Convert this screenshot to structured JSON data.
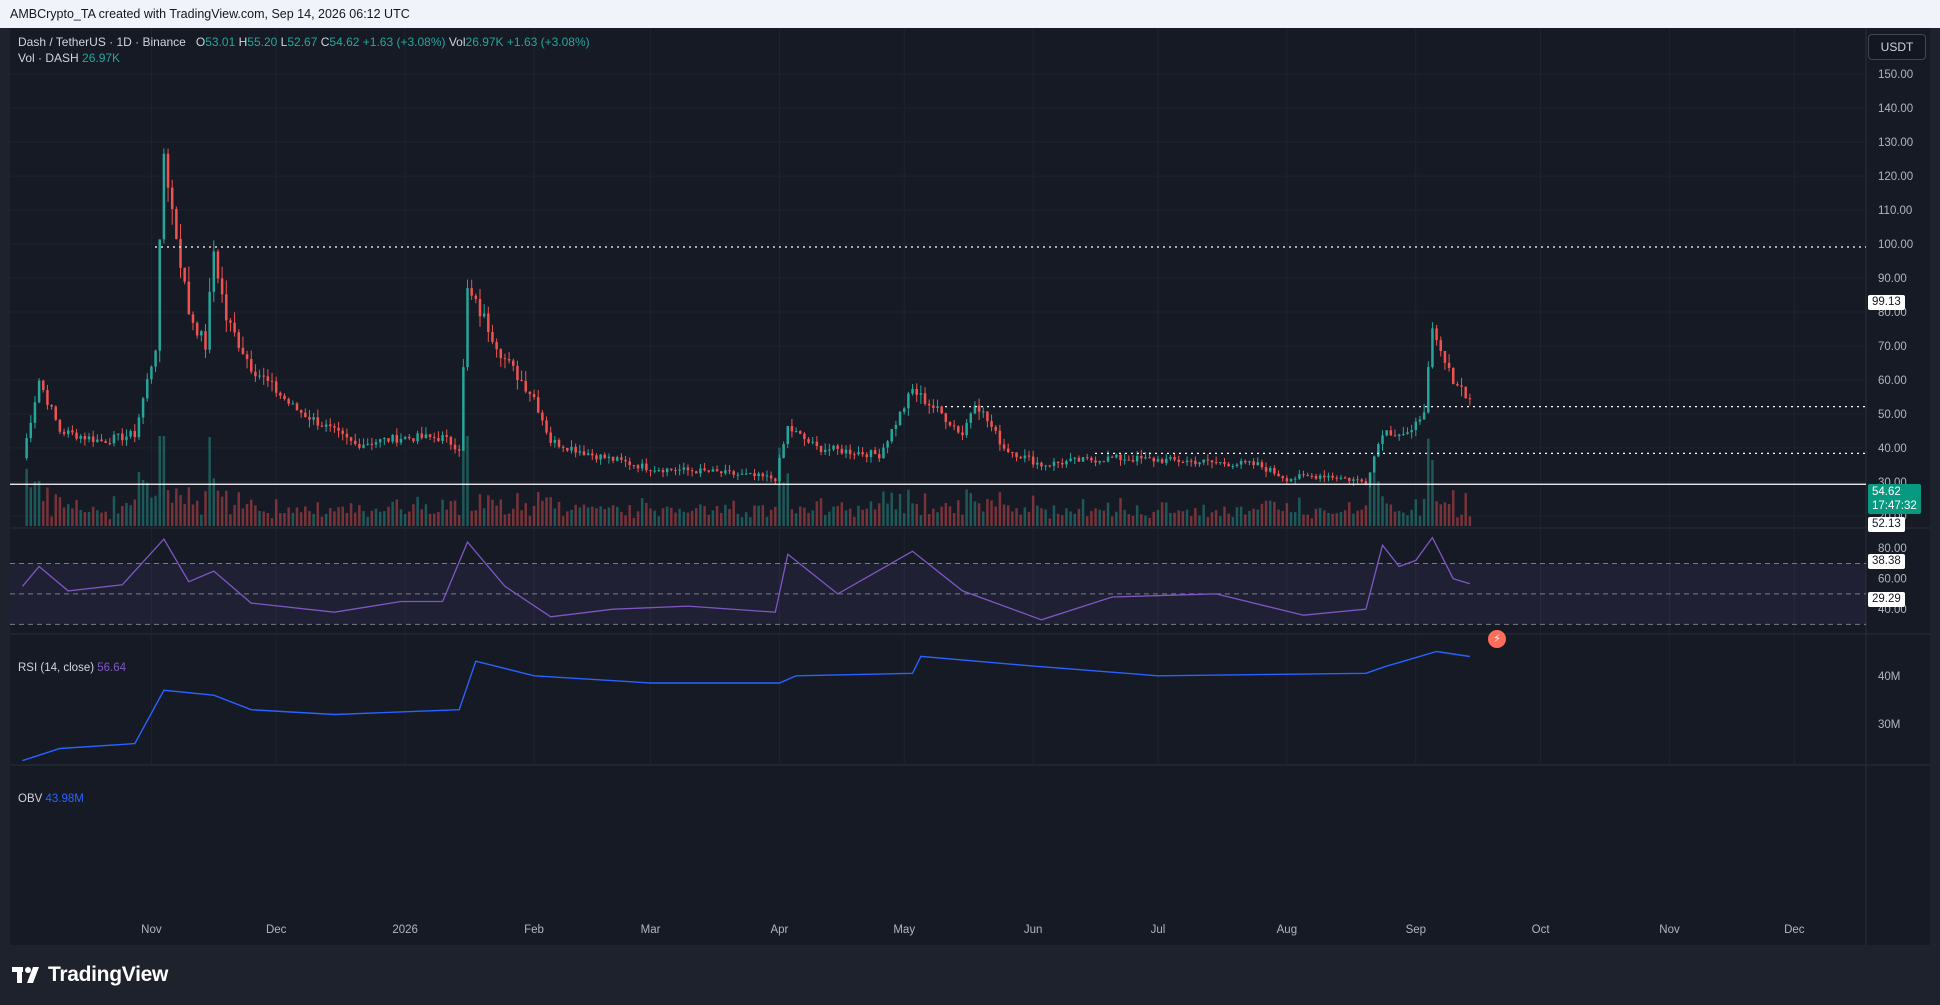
{
  "header": {
    "attribution": "AMBCrypto_TA created with TradingView.com, Sep 14, 2026 06:12 UTC"
  },
  "legend": {
    "symbol": "Dash / TetherUS · 1D · Binance",
    "o_label": "O",
    "o_value": "53.01",
    "h_label": "H",
    "h_value": "55.20",
    "l_label": "L",
    "l_value": "52.67",
    "c_label": "C",
    "c_value": "54.62",
    "change": "+1.63 (+3.08%)",
    "vol_label": "Vol",
    "vol_value": "26.97K",
    "vol_change": "+1.63 (+3.08%)",
    "vol_series_label": "Vol · DASH",
    "vol_series_value": "26.97K"
  },
  "rsi_legend": {
    "label": "RSI (14, close)",
    "value": "56.64"
  },
  "obv_legend": {
    "label": "OBV",
    "value": "43.98M"
  },
  "toolbar": {
    "currency": "USDT"
  },
  "price_tags": {
    "level_1": "99.13",
    "current": "54.62",
    "countdown": "17:47:32",
    "level_2": "52.13",
    "level_3": "38.38",
    "level_4": "29.29"
  },
  "footer": {
    "brand": "TradingView"
  },
  "colors": {
    "bg": "#161a25",
    "up": "#26a69a",
    "down": "#ef5350",
    "rsi": "#7e57c2",
    "obv": "#2962ff"
  },
  "chart_data": [
    {
      "type": "candlestick",
      "title": "Dash / TetherUS · 1D · Binance",
      "price_axis_ticks": [
        "150.00",
        "140.00",
        "130.00",
        "120.00",
        "110.00",
        "100.00",
        "90.00",
        "80.00",
        "70.00",
        "60.00",
        "50.00",
        "40.00",
        "30.00",
        "20.00"
      ],
      "time_axis_labels": [
        "Nov",
        "Dec",
        "2026",
        "Feb",
        "Mar",
        "Apr",
        "May",
        "Jun",
        "Jul",
        "Aug",
        "Sep",
        "Oct",
        "Nov",
        "Dec"
      ],
      "ylim": [
        17,
        153
      ],
      "horizontal_levels": [
        99.13,
        52.13,
        38.38,
        29.29
      ],
      "current_price": 54.62,
      "key_points": [
        {
          "date": "2025-10-01",
          "price": 37
        },
        {
          "date": "2025-10-05",
          "price": 60
        },
        {
          "date": "2025-10-10",
          "price": 45
        },
        {
          "date": "2025-10-20",
          "price": 42
        },
        {
          "date": "2025-10-28",
          "price": 44
        },
        {
          "date": "2025-11-02",
          "price": 70
        },
        {
          "date": "2025-11-04",
          "price": 127
        },
        {
          "date": "2025-11-06",
          "price": 110
        },
        {
          "date": "2025-11-10",
          "price": 80
        },
        {
          "date": "2025-11-14",
          "price": 70
        },
        {
          "date": "2025-11-16",
          "price": 98
        },
        {
          "date": "2025-11-19",
          "price": 78
        },
        {
          "date": "2025-11-25",
          "price": 64
        },
        {
          "date": "2025-12-05",
          "price": 52
        },
        {
          "date": "2025-12-20",
          "price": 41
        },
        {
          "date": "2025-12-31",
          "price": 43
        },
        {
          "date": "2026-01-10",
          "price": 43
        },
        {
          "date": "2026-01-14",
          "price": 40
        },
        {
          "date": "2026-01-16",
          "price": 86
        },
        {
          "date": "2026-01-20",
          "price": 78
        },
        {
          "date": "2026-01-25",
          "price": 66
        },
        {
          "date": "2026-02-01",
          "price": 55
        },
        {
          "date": "2026-02-05",
          "price": 42
        },
        {
          "date": "2026-02-15",
          "price": 38
        },
        {
          "date": "2026-03-01",
          "price": 34
        },
        {
          "date": "2026-03-15",
          "price": 33
        },
        {
          "date": "2026-03-31",
          "price": 31
        },
        {
          "date": "2026-04-03",
          "price": 46
        },
        {
          "date": "2026-04-10",
          "price": 40
        },
        {
          "date": "2026-04-25",
          "price": 38
        },
        {
          "date": "2026-05-03",
          "price": 57
        },
        {
          "date": "2026-05-10",
          "price": 50
        },
        {
          "date": "2026-05-15",
          "price": 44
        },
        {
          "date": "2026-05-18",
          "price": 54
        },
        {
          "date": "2026-05-25",
          "price": 40
        },
        {
          "date": "2026-06-03",
          "price": 35
        },
        {
          "date": "2026-06-10",
          "price": 36
        },
        {
          "date": "2026-06-20",
          "price": 37
        },
        {
          "date": "2026-07-10",
          "price": 36
        },
        {
          "date": "2026-07-25",
          "price": 35
        },
        {
          "date": "2026-08-01",
          "price": 31
        },
        {
          "date": "2026-08-10",
          "price": 32
        },
        {
          "date": "2026-08-20",
          "price": 30
        },
        {
          "date": "2026-08-24",
          "price": 45
        },
        {
          "date": "2026-08-31",
          "price": 44
        },
        {
          "date": "2026-09-03",
          "price": 52
        },
        {
          "date": "2026-09-05",
          "price": 73
        },
        {
          "date": "2026-09-09",
          "price": 62
        },
        {
          "date": "2026-09-14",
          "price": 54.62
        }
      ]
    },
    {
      "type": "line",
      "title": "RSI (14, close)",
      "axis_ticks": [
        "80.00",
        "60.00",
        "40.00"
      ],
      "ylim": [
        25,
        90
      ],
      "bands": [
        70,
        50,
        30
      ],
      "last_value": 56.64,
      "points": [
        {
          "date": "2025-10-01",
          "value": 55
        },
        {
          "date": "2025-10-05",
          "value": 68
        },
        {
          "date": "2025-10-12",
          "value": 52
        },
        {
          "date": "2025-10-25",
          "value": 56
        },
        {
          "date": "2025-11-04",
          "value": 86
        },
        {
          "date": "2025-11-10",
          "value": 58
        },
        {
          "date": "2025-11-16",
          "value": 65
        },
        {
          "date": "2025-11-25",
          "value": 44
        },
        {
          "date": "2025-12-15",
          "value": 38
        },
        {
          "date": "2025-12-31",
          "value": 45
        },
        {
          "date": "2026-01-10",
          "value": 45
        },
        {
          "date": "2026-01-16",
          "value": 84
        },
        {
          "date": "2026-01-25",
          "value": 55
        },
        {
          "date": "2026-02-05",
          "value": 35
        },
        {
          "date": "2026-02-20",
          "value": 40
        },
        {
          "date": "2026-03-10",
          "value": 42
        },
        {
          "date": "2026-03-31",
          "value": 38
        },
        {
          "date": "2026-04-03",
          "value": 76
        },
        {
          "date": "2026-04-15",
          "value": 50
        },
        {
          "date": "2026-05-03",
          "value": 78
        },
        {
          "date": "2026-05-15",
          "value": 52
        },
        {
          "date": "2026-06-03",
          "value": 33
        },
        {
          "date": "2026-06-20",
          "value": 48
        },
        {
          "date": "2026-07-15",
          "value": 50
        },
        {
          "date": "2026-08-05",
          "value": 36
        },
        {
          "date": "2026-08-20",
          "value": 40
        },
        {
          "date": "2026-08-24",
          "value": 82
        },
        {
          "date": "2026-08-28",
          "value": 68
        },
        {
          "date": "2026-09-01",
          "value": 72
        },
        {
          "date": "2026-09-05",
          "value": 87
        },
        {
          "date": "2026-09-10",
          "value": 60
        },
        {
          "date": "2026-09-14",
          "value": 56.64
        }
      ]
    },
    {
      "type": "line",
      "title": "OBV",
      "axis_ticks": [
        "40M",
        "30M"
      ],
      "ylim": [
        22,
        48
      ],
      "last_value": 43.98,
      "unit": "M",
      "points": [
        {
          "date": "2025-10-01",
          "value": 22.5
        },
        {
          "date": "2025-10-10",
          "value": 25
        },
        {
          "date": "2025-10-28",
          "value": 26
        },
        {
          "date": "2025-11-04",
          "value": 37
        },
        {
          "date": "2025-11-16",
          "value": 36
        },
        {
          "date": "2025-11-25",
          "value": 33
        },
        {
          "date": "2025-12-15",
          "value": 32
        },
        {
          "date": "2026-01-14",
          "value": 33
        },
        {
          "date": "2026-01-18",
          "value": 43
        },
        {
          "date": "2026-02-01",
          "value": 40
        },
        {
          "date": "2026-03-01",
          "value": 38.5
        },
        {
          "date": "2026-04-01",
          "value": 38.5
        },
        {
          "date": "2026-04-05",
          "value": 40
        },
        {
          "date": "2026-05-03",
          "value": 40.5
        },
        {
          "date": "2026-05-05",
          "value": 44
        },
        {
          "date": "2026-06-01",
          "value": 42
        },
        {
          "date": "2026-07-01",
          "value": 40
        },
        {
          "date": "2026-08-20",
          "value": 40.5
        },
        {
          "date": "2026-08-25",
          "value": 42
        },
        {
          "date": "2026-09-06",
          "value": 45
        },
        {
          "date": "2026-09-14",
          "value": 43.98
        }
      ]
    }
  ]
}
